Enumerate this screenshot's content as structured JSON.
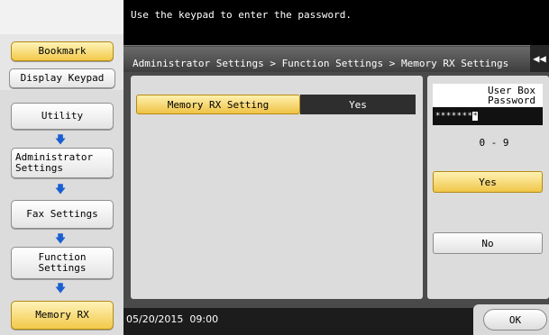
{
  "header": {
    "message": "Use the keypad to enter the password."
  },
  "sidebar": {
    "bookmark": "Bookmark",
    "display_keypad": "Display Keypad",
    "nav": [
      {
        "label": "Utility"
      },
      {
        "label": "Administrator\nSettings"
      },
      {
        "label": "Fax Settings"
      },
      {
        "label": "Function\nSettings"
      },
      {
        "label": "Memory RX"
      }
    ]
  },
  "main": {
    "breadcrumb": "Administrator Settings > Function Settings > Memory RX Settings",
    "collapse_icon": "double-chevron-left-icon",
    "setting_label": "Memory RX Setting",
    "setting_value": "Yes"
  },
  "password_panel": {
    "title": "User Box\nPassword",
    "masked_value": "*******",
    "cursor_char": "*",
    "range": "0 - 9",
    "yes_label": "Yes",
    "no_label": "No"
  },
  "footer": {
    "datetime": "05/20/2015  09:00",
    "ok_label": "OK"
  },
  "colors": {
    "accent_gold": "#f0c648",
    "arrow_blue": "#1a5fd0",
    "dark_value_bg": "#2e2e2e"
  }
}
